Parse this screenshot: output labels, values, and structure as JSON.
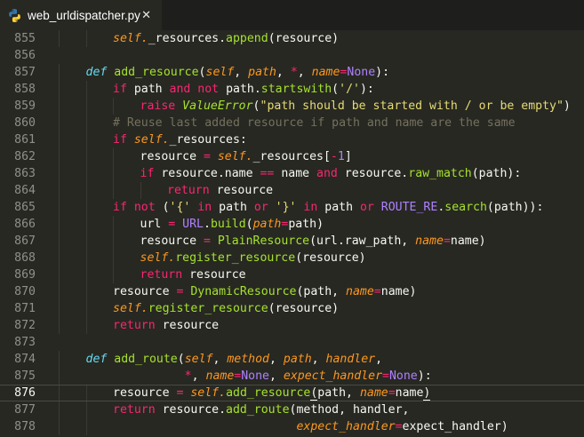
{
  "tab": {
    "filename": "web_urldispatcher.py",
    "icon": "python-icon",
    "close_glyph": "✕"
  },
  "editor": {
    "current_line": 876,
    "lines": [
      {
        "n": "855",
        "indent": 2,
        "tokens": [
          [
            "self",
            "self."
          ],
          [
            "",
            "_resources."
          ],
          [
            "fn",
            "append"
          ],
          [
            "",
            "(resource)"
          ]
        ]
      },
      {
        "n": "856",
        "indent": 0,
        "tokens": []
      },
      {
        "n": "857",
        "indent": 1,
        "tokens": [
          [
            "def",
            "def "
          ],
          [
            "fn",
            "add_resource"
          ],
          [
            "",
            "("
          ],
          [
            "self",
            "self"
          ],
          [
            "",
            ", "
          ],
          [
            "param",
            "path"
          ],
          [
            "",
            ", "
          ],
          [
            "op",
            "*"
          ],
          [
            "",
            ", "
          ],
          [
            "param",
            "name"
          ],
          [
            "op",
            "="
          ],
          [
            "const",
            "None"
          ],
          [
            "",
            "):"
          ]
        ]
      },
      {
        "n": "858",
        "indent": 2,
        "tokens": [
          [
            "kw",
            "if "
          ],
          [
            "",
            "path "
          ],
          [
            "kw",
            "and not "
          ],
          [
            "",
            "path."
          ],
          [
            "fn",
            "startswith"
          ],
          [
            "",
            "("
          ],
          [
            "str",
            "'/'"
          ],
          [
            "",
            "):"
          ]
        ]
      },
      {
        "n": "859",
        "indent": 3,
        "tokens": [
          [
            "kw",
            "raise "
          ],
          [
            "cls",
            "ValueError"
          ],
          [
            "",
            "("
          ],
          [
            "str",
            "\"path should be started with / or be empty\""
          ],
          [
            "",
            ")"
          ]
        ]
      },
      {
        "n": "860",
        "indent": 2,
        "tokens": [
          [
            "cmt",
            "# Reuse last added resource if path and name are the same"
          ]
        ]
      },
      {
        "n": "861",
        "indent": 2,
        "tokens": [
          [
            "kw",
            "if "
          ],
          [
            "self",
            "self."
          ],
          [
            "",
            "_resources:"
          ]
        ]
      },
      {
        "n": "862",
        "indent": 3,
        "tokens": [
          [
            "",
            "resource "
          ],
          [
            "op",
            "= "
          ],
          [
            "self",
            "self."
          ],
          [
            "",
            "_resources["
          ],
          [
            "op",
            "-"
          ],
          [
            "num",
            "1"
          ],
          [
            "",
            "]"
          ]
        ]
      },
      {
        "n": "863",
        "indent": 3,
        "tokens": [
          [
            "kw",
            "if "
          ],
          [
            "",
            "resource.name "
          ],
          [
            "op",
            "== "
          ],
          [
            "",
            "name "
          ],
          [
            "kw",
            "and "
          ],
          [
            "",
            "resource."
          ],
          [
            "fn",
            "raw_match"
          ],
          [
            "",
            "(path):"
          ]
        ]
      },
      {
        "n": "864",
        "indent": 4,
        "tokens": [
          [
            "kw",
            "return "
          ],
          [
            "",
            "resource"
          ]
        ]
      },
      {
        "n": "865",
        "indent": 2,
        "tokens": [
          [
            "kw",
            "if not "
          ],
          [
            "",
            "("
          ],
          [
            "str",
            "'{'"
          ],
          [
            "kw",
            " in "
          ],
          [
            "",
            "path "
          ],
          [
            "kw",
            "or "
          ],
          [
            "str",
            "'}'"
          ],
          [
            "kw",
            " in "
          ],
          [
            "",
            "path "
          ],
          [
            "kw",
            "or "
          ],
          [
            "const",
            "ROUTE_RE"
          ],
          [
            "",
            "."
          ],
          [
            "fn",
            "search"
          ],
          [
            "",
            "(path)):"
          ]
        ]
      },
      {
        "n": "866",
        "indent": 3,
        "tokens": [
          [
            "",
            "url "
          ],
          [
            "op",
            "= "
          ],
          [
            "const",
            "URL"
          ],
          [
            "",
            "."
          ],
          [
            "fn",
            "build"
          ],
          [
            "",
            "("
          ],
          [
            "param",
            "path"
          ],
          [
            "op",
            "="
          ],
          [
            "",
            "path)"
          ]
        ]
      },
      {
        "n": "867",
        "indent": 3,
        "tokens": [
          [
            "",
            "resource "
          ],
          [
            "op",
            "= "
          ],
          [
            "fn",
            "PlainResource"
          ],
          [
            "",
            "(url.raw_path, "
          ],
          [
            "param",
            "name"
          ],
          [
            "op",
            "="
          ],
          [
            "",
            "name)"
          ]
        ]
      },
      {
        "n": "868",
        "indent": 3,
        "tokens": [
          [
            "self",
            "self."
          ],
          [
            "fn",
            "register_resource"
          ],
          [
            "",
            "(resource)"
          ]
        ]
      },
      {
        "n": "869",
        "indent": 3,
        "tokens": [
          [
            "kw",
            "return "
          ],
          [
            "",
            "resource"
          ]
        ]
      },
      {
        "n": "870",
        "indent": 2,
        "tokens": [
          [
            "",
            "resource "
          ],
          [
            "op",
            "= "
          ],
          [
            "fn",
            "DynamicResource"
          ],
          [
            "",
            "(path, "
          ],
          [
            "param",
            "name"
          ],
          [
            "op",
            "="
          ],
          [
            "",
            "name)"
          ]
        ]
      },
      {
        "n": "871",
        "indent": 2,
        "tokens": [
          [
            "self",
            "self."
          ],
          [
            "fn",
            "register_resource"
          ],
          [
            "",
            "(resource)"
          ]
        ]
      },
      {
        "n": "872",
        "indent": 2,
        "tokens": [
          [
            "kw",
            "return "
          ],
          [
            "",
            "resource"
          ]
        ]
      },
      {
        "n": "873",
        "indent": 0,
        "tokens": []
      },
      {
        "n": "874",
        "indent": 1,
        "tokens": [
          [
            "def",
            "def "
          ],
          [
            "fn",
            "add_route"
          ],
          [
            "",
            "("
          ],
          [
            "self",
            "self"
          ],
          [
            "",
            ", "
          ],
          [
            "param",
            "method"
          ],
          [
            "",
            ", "
          ],
          [
            "param",
            "path"
          ],
          [
            "",
            ", "
          ],
          [
            "param",
            "handler"
          ],
          [
            "",
            ","
          ]
        ]
      },
      {
        "n": "875",
        "indent": 1,
        "pad": "              ",
        "tokens": [
          [
            "op",
            "*"
          ],
          [
            "",
            ", "
          ],
          [
            "param",
            "name"
          ],
          [
            "op",
            "="
          ],
          [
            "const",
            "None"
          ],
          [
            "",
            ", "
          ],
          [
            "param",
            "expect_handler"
          ],
          [
            "op",
            "="
          ],
          [
            "const",
            "None"
          ],
          [
            "",
            "):"
          ]
        ]
      },
      {
        "n": "876",
        "indent": 2,
        "tokens": [
          [
            "",
            "resource "
          ],
          [
            "op",
            "= "
          ],
          [
            "self",
            "self."
          ],
          [
            "fn",
            "add_resource"
          ],
          [
            "bracket",
            "("
          ],
          [
            "",
            "path, "
          ],
          [
            "param",
            "name"
          ],
          [
            "op",
            "="
          ],
          [
            "",
            "name"
          ],
          [
            "bracket",
            ")"
          ]
        ]
      },
      {
        "n": "877",
        "indent": 2,
        "tokens": [
          [
            "kw",
            "return "
          ],
          [
            "",
            "resource."
          ],
          [
            "fn",
            "add_route"
          ],
          [
            "",
            "(method, handler,"
          ]
        ]
      },
      {
        "n": "878",
        "indent": 2,
        "pad": "                          ",
        "tokens": [
          [
            "param",
            "expect_handler"
          ],
          [
            "op",
            "="
          ],
          [
            "",
            "expect_handler)"
          ]
        ]
      }
    ]
  }
}
